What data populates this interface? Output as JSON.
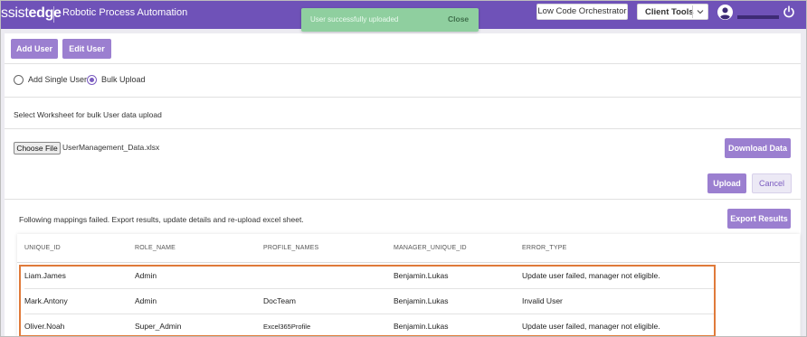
{
  "header": {
    "logo_prefix": "ssist",
    "logo_bold": "edge",
    "app_title": "Robotic Process Automation",
    "low_code_button": "Low Code Orchestrator",
    "client_tools_button": "Client Tools"
  },
  "toast": {
    "message": "User successfully uploaded",
    "close_label": "Close"
  },
  "toolbar": {
    "add_user": "Add User",
    "edit_user": "Edit User"
  },
  "mode": {
    "single_label": "Add Single User",
    "bulk_label": "Bulk Upload",
    "selected": "Bulk Upload"
  },
  "upload": {
    "instruction": "Select Worksheet for bulk User data upload",
    "choose_file": "Choose File",
    "file_name": "UserManagement_Data.xlsx",
    "download_data": "Download Data",
    "upload_button": "Upload",
    "cancel_button": "Cancel"
  },
  "results": {
    "message": "Following mappings failed. Export results, update details and re-upload excel sheet.",
    "export_button": "Export Results",
    "columns": [
      "UNIQUE_ID",
      "ROLE_NAME",
      "PROFILE_NAMES",
      "MANAGER_UNIQUE_ID",
      "ERROR_TYPE"
    ],
    "rows": [
      [
        "Liam.James",
        "Admin",
        "",
        "Benjamin.Lukas",
        "Update user failed, manager not eligible."
      ],
      [
        "Mark.Antony",
        "Admin",
        "DocTeam",
        "Benjamin.Lukas",
        "Invalid User"
      ],
      [
        "Oliver.Noah",
        "Super_Admin",
        "Excel365Profile",
        "Benjamin.Lukas",
        "Update user failed, manager not eligible."
      ]
    ]
  },
  "colors": {
    "header_bg": "#6f52b8",
    "primary_button": "#9b7fd0",
    "toast_bg": "#8fcf9f",
    "highlight_border": "#e07a3a"
  },
  "icons": {
    "avatar": "user-circle-icon",
    "power": "power-icon",
    "dropdown": "chevron-down-icon"
  }
}
